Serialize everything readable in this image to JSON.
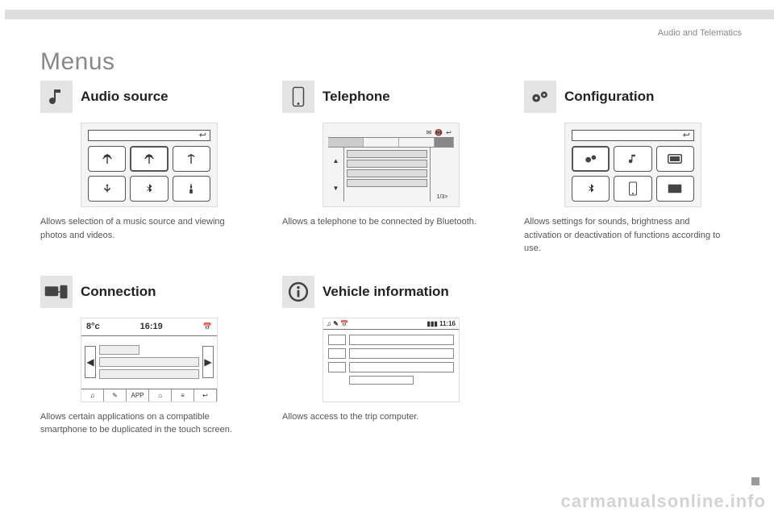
{
  "header": {
    "section_label": "Audio and Telematics"
  },
  "page": {
    "title": "Menus"
  },
  "menus": {
    "audio_source": {
      "title": "Audio source",
      "description": "Allows selection of a music source and viewing photos and videos.",
      "screenshot": {
        "tiles": [
          "antenna",
          "antenna-highlight",
          "antenna",
          "usb",
          "bluetooth",
          "aux"
        ]
      }
    },
    "telephone": {
      "title": "Telephone",
      "description": "Allows a telephone to be connected by Bluetooth.",
      "screenshot": {
        "topbar_icons": [
          "✉",
          "📵",
          "↩"
        ],
        "side_icons": [
          "▲",
          "▼"
        ],
        "pager": "1/3>"
      }
    },
    "configuration": {
      "title": "Configuration",
      "description": "Allows settings for sounds, brightness and activation or deactivation of functions according to use.",
      "screenshot": {
        "tiles": [
          "gears",
          "music",
          "display",
          "bluetooth",
          "phone",
          "screen"
        ]
      }
    },
    "connection": {
      "title": "Connection",
      "description": "Allows certain applications on a compatible smartphone to be duplicated in the touch screen.",
      "screenshot": {
        "temp": "8°c",
        "time": "16:19",
        "corner_icon": "📅",
        "bottom_bar": [
          "♫",
          "✎",
          "APP",
          "⌂",
          "≡",
          "↩"
        ]
      }
    },
    "vehicle_info": {
      "title": "Vehicle information",
      "description": "Allows access to the trip computer.",
      "screenshot": {
        "topbar_left": "♫ ✎ 📅",
        "topbar_right": "▮▮▮ 11:16"
      }
    }
  },
  "watermark": "carmanualsonline.info"
}
